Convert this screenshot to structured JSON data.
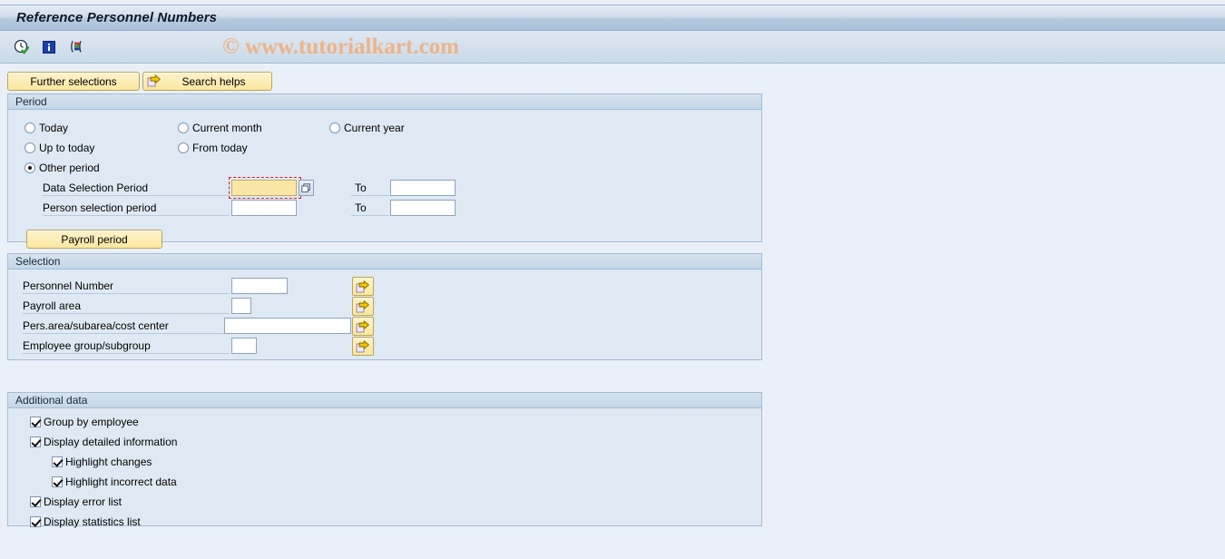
{
  "window": {
    "title": "Reference Personnel Numbers"
  },
  "watermark": "© www.tutorialkart.com",
  "toolbar": {
    "icons": [
      {
        "name": "execute-clock-icon",
        "tooltip": "Execute"
      },
      {
        "name": "info-icon",
        "tooltip": "Information"
      },
      {
        "name": "variant-icon",
        "tooltip": "Get Variant"
      }
    ]
  },
  "buttons": {
    "further_selections": "Further selections",
    "search_helps": "Search helps",
    "payroll_period": "Payroll period"
  },
  "period": {
    "header": "Period",
    "radios": [
      {
        "label": "Today",
        "selected": false
      },
      {
        "label": "Current month",
        "selected": false
      },
      {
        "label": "Current year",
        "selected": false
      },
      {
        "label": "Up to today",
        "selected": false
      },
      {
        "label": "From today",
        "selected": false
      },
      {
        "label": "Other period",
        "selected": true
      }
    ],
    "rows": [
      {
        "label": "Data Selection Period",
        "from_value": "",
        "to_label": "To",
        "to_value": "",
        "focused": true,
        "has_f4": true
      },
      {
        "label": "Person selection period",
        "from_value": "",
        "to_label": "To",
        "to_value": "",
        "focused": false,
        "has_f4": false
      }
    ]
  },
  "selection": {
    "header": "Selection",
    "rows": [
      {
        "label": "Personnel Number",
        "value": ""
      },
      {
        "label": "Payroll area",
        "value": ""
      },
      {
        "label": "Pers.area/subarea/cost center",
        "value": ""
      },
      {
        "label": "Employee group/subgroup",
        "value": ""
      }
    ],
    "multi_select_tooltip": "Multiple selection"
  },
  "additional_data": {
    "header": "Additional data",
    "checkboxes": [
      {
        "label": "Group by employee",
        "checked": true,
        "indent": 0
      },
      {
        "label": "Display detailed information",
        "checked": true,
        "indent": 0
      },
      {
        "label": "Highlight changes",
        "checked": true,
        "indent": 1
      },
      {
        "label": "Highlight incorrect data",
        "checked": true,
        "indent": 1
      },
      {
        "label": "Display error list",
        "checked": true,
        "indent": 0
      },
      {
        "label": "Display statistics list",
        "checked": true,
        "indent": 0
      }
    ]
  },
  "colors": {
    "window_bg": "#eaf0f7",
    "panel_bg": "#dfe9f3",
    "panel_border": "#a3bdd6",
    "title_gradient_end": "#a8c0d8",
    "button_yellow": "#fbe79f",
    "focus_field_yellow": "#fae7a8",
    "focus_outline_red": "#d02020",
    "watermark": "#f0b183"
  }
}
